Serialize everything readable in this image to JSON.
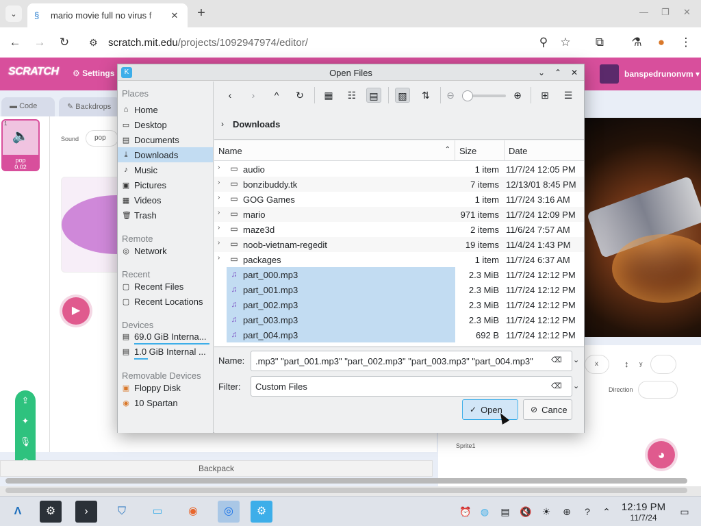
{
  "browser": {
    "tab_title": "mario movie full no virus f",
    "url_host": "scratch.mit.edu",
    "url_path": "/projects/1092947974/editor/"
  },
  "scratch": {
    "settings": "Settings",
    "username": "banspedrunonvm",
    "tab_code": "Code",
    "tab_backdrops": "Backdrops",
    "sound_label": "Sound",
    "sound_name": "pop",
    "sound_item_name": "pop",
    "sound_item_dur": "0.02",
    "sound_item_index": "1",
    "backpack": "Backpack",
    "x_label": "x",
    "y_label": "y",
    "direction": "Direction",
    "sprite_name": "Sprite1"
  },
  "dialog": {
    "title": "Open Files",
    "places": {
      "places_head": "Places",
      "items": [
        "Home",
        "Desktop",
        "Documents",
        "Downloads",
        "Music",
        "Pictures",
        "Videos",
        "Trash"
      ],
      "remote_head": "Remote",
      "network": "Network",
      "recent_head": "Recent",
      "recent_files": "Recent Files",
      "recent_locations": "Recent Locations",
      "devices_head": "Devices",
      "dev1": "69.0 GiB Interna...",
      "dev2": "1.0 GiB Internal ...",
      "removable_head": "Removable Devices",
      "floppy": "Floppy Disk",
      "spartan": "10 Spartan"
    },
    "breadcrumb": "Downloads",
    "columns": {
      "name": "Name",
      "size": "Size",
      "date": "Date"
    },
    "files": [
      {
        "name": "audio",
        "size": "1 item",
        "date": "11/7/24 12:05 PM"
      },
      {
        "name": "bonzibuddy.tk",
        "size": "7 items",
        "date": "12/13/01 8:45 PM"
      },
      {
        "name": "GOG Games",
        "size": "1 item",
        "date": "11/7/24 3:16 AM"
      },
      {
        "name": "mario",
        "size": "971 items",
        "date": "11/7/24 12:09 PM"
      },
      {
        "name": "maze3d",
        "size": "2 items",
        "date": "11/6/24 7:57 AM"
      },
      {
        "name": "noob-vietnam-regedit",
        "size": "19 items",
        "date": "11/4/24 1:43 PM"
      },
      {
        "name": "packages",
        "size": "1 item",
        "date": "11/7/24 6:37 AM"
      },
      {
        "name": "part_000.mp3",
        "size": "2.3 MiB",
        "date": "11/7/24 12:12 PM"
      },
      {
        "name": "part_001.mp3",
        "size": "2.3 MiB",
        "date": "11/7/24 12:12 PM"
      },
      {
        "name": "part_002.mp3",
        "size": "2.3 MiB",
        "date": "11/7/24 12:12 PM"
      },
      {
        "name": "part_003.mp3",
        "size": "2.3 MiB",
        "date": "11/7/24 12:12 PM"
      },
      {
        "name": "part_004.mp3",
        "size": "692 B",
        "date": "11/7/24 12:12 PM"
      }
    ],
    "name_label": "Name:",
    "name_value": ".mp3\" \"part_001.mp3\" \"part_002.mp3\" \"part_003.mp3\" \"part_004.mp3\"",
    "filter_label": "Filter:",
    "filter_value": "Custom Files",
    "open_btn": "Open",
    "cancel_btn": "Cance"
  },
  "taskbar": {
    "time": "12:19 PM",
    "date": "11/7/24"
  },
  "icons": {
    "folder": "folder-icon",
    "music_file": "music-file-icon",
    "accent": "#3daee9",
    "selection": "#c2dcf2",
    "scratch_pink": "#d84f9c"
  }
}
